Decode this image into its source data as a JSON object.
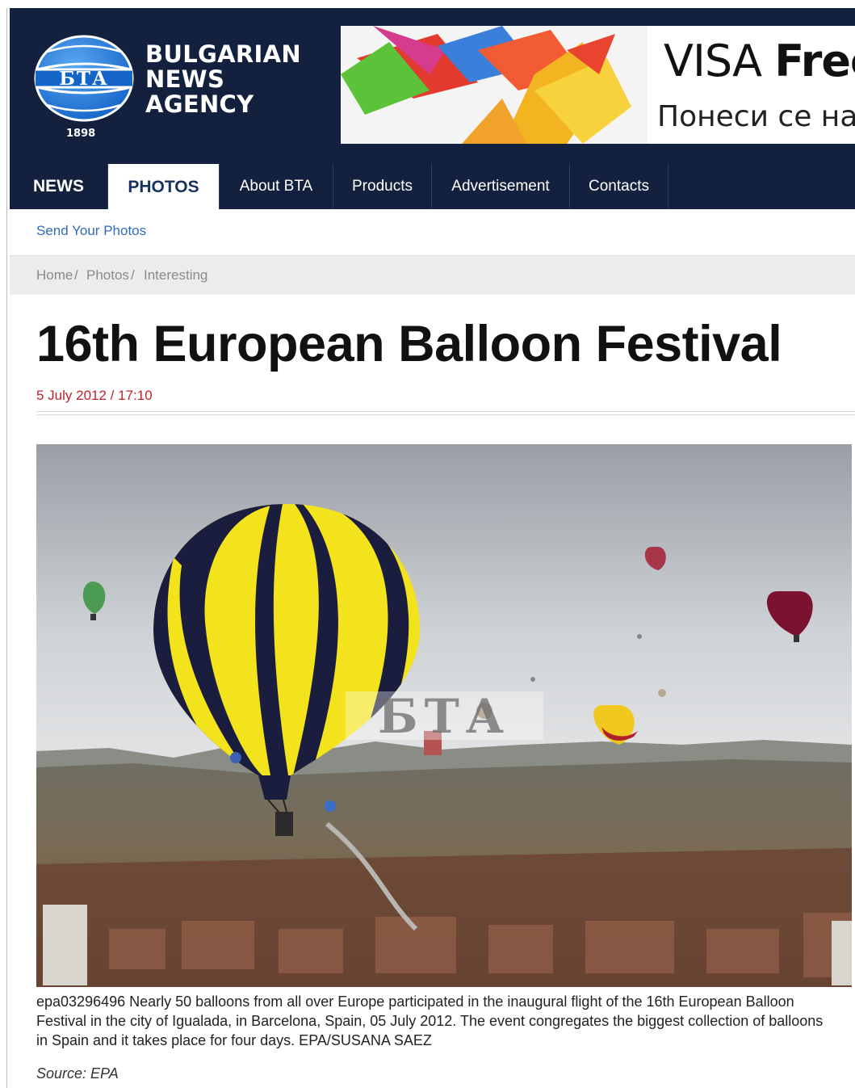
{
  "logo": {
    "abbr": "БТА",
    "name_lines": [
      "BULGARIAN",
      "NEWS",
      "AGENCY"
    ],
    "year": "1898"
  },
  "banner": {
    "title_light": "VISA ",
    "title_bold": "Free",
    "subtitle": "Понеси се на к"
  },
  "nav": {
    "items": [
      {
        "label": "NEWS"
      },
      {
        "label": "PHOTOS"
      },
      {
        "label": "About BTA"
      },
      {
        "label": "Products"
      },
      {
        "label": "Advertisement"
      },
      {
        "label": "Contacts"
      }
    ],
    "active": "PHOTOS"
  },
  "subnav": {
    "send_photos": "Send Your Photos"
  },
  "breadcrumb": {
    "home": "Home",
    "photos": "Photos",
    "interesting": "Interesting",
    "separator": " / "
  },
  "article": {
    "title": "16th European Balloon Festival",
    "date": "5 July 2012 / 17:10",
    "watermark": "БТА",
    "caption": "epa03296496 Nearly 50 balloons from all over Europe participated in the inaugural flight of the 16th European Balloon Festival in the city of Igualada, in Barcelona, Spain, 05 July 2012. The event congregates the biggest collection of balloons in Spain and it takes place for four days. EPA/SUSANA SAEZ",
    "source": "Source: EPA"
  },
  "colors": {
    "header_bg": "#13213f",
    "link": "#2f6db8",
    "date_red": "#c0222a",
    "balloon_yellow": "#f3e31c",
    "balloon_navy": "#1a1d3d"
  }
}
